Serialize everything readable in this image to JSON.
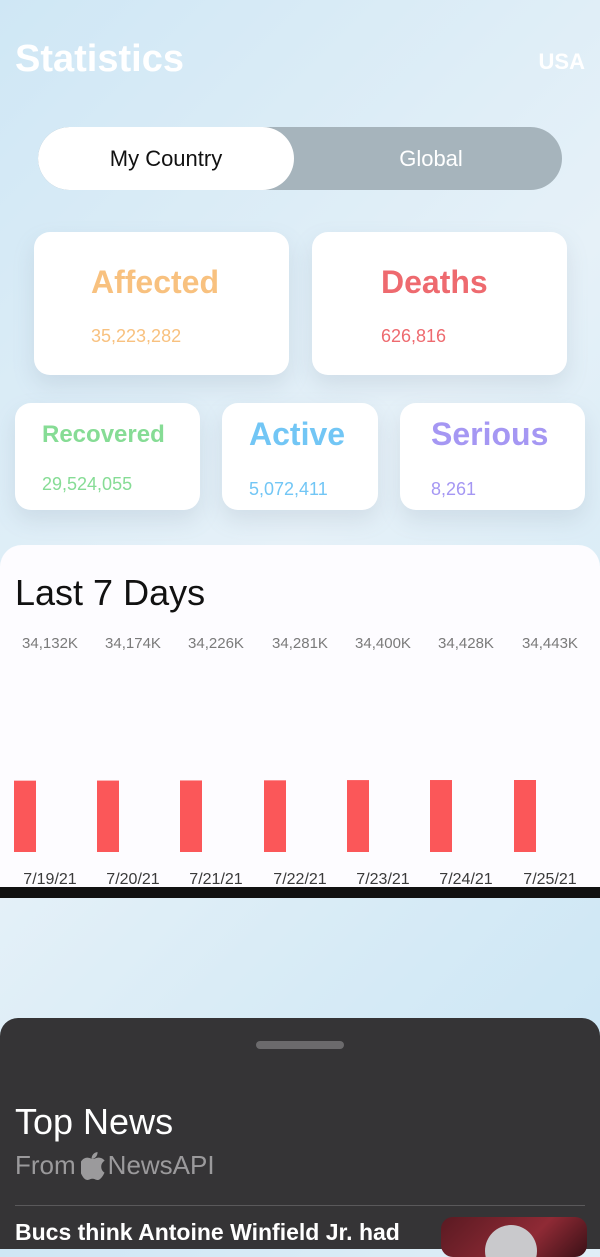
{
  "header": {
    "title": "Statistics",
    "country": "USA"
  },
  "segmented": {
    "options": [
      "My Country",
      "Global"
    ],
    "selected": "My Country"
  },
  "stats": [
    {
      "label": "Affected",
      "value": "35,223,282",
      "color": "#f8c17f"
    },
    {
      "label": "Deaths",
      "value": "626,816",
      "color": "#ee6a6f"
    },
    {
      "label": "Recovered",
      "value": "29,524,055",
      "color": "#86dc95"
    },
    {
      "label": "Active",
      "value": "5,072,411",
      "color": "#72c6f5"
    },
    {
      "label": "Serious",
      "value": "8,261",
      "color": "#a597f3"
    }
  ],
  "chart_data": {
    "type": "bar",
    "title": "Last 7 Days",
    "categories": [
      "7/19/21",
      "7/20/21",
      "7/21/21",
      "7/22/21",
      "7/23/21",
      "7/24/21",
      "7/25/21"
    ],
    "value_labels": [
      "34,132K",
      "34,174K",
      "34,226K",
      "34,281K",
      "34,400K",
      "34,428K",
      "34,443K"
    ],
    "values": [
      34132,
      34174,
      34226,
      34281,
      34400,
      34428,
      34443
    ],
    "bar_color": "#fb5759",
    "grid": false
  },
  "news": {
    "title": "Top News",
    "from_prefix": "From",
    "source": "NewsAPI",
    "source_icon": "apple-icon",
    "headline": "Bucs think Antoine Winfield Jr. had"
  }
}
